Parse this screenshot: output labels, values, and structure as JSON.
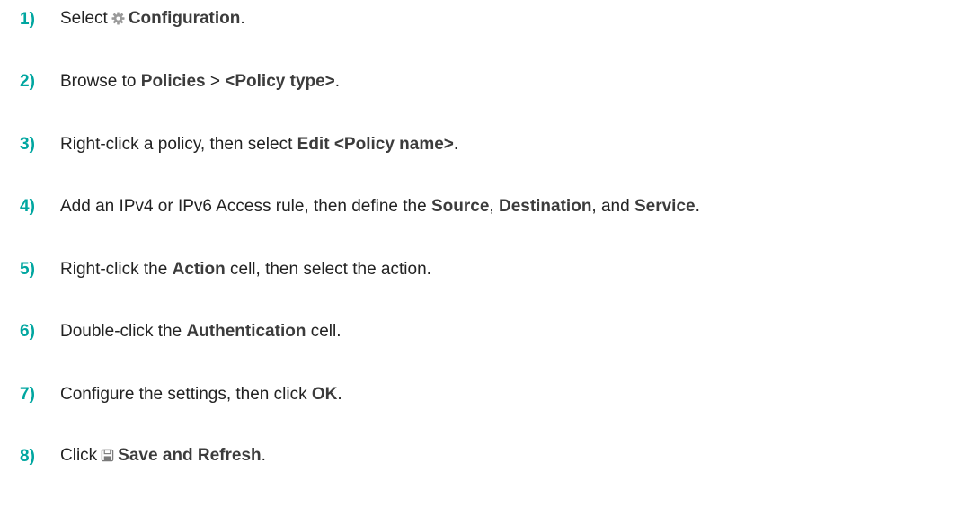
{
  "steps": [
    {
      "number": "1)",
      "parts": [
        "Select",
        "Configuration",
        "."
      ],
      "icon": "gear-icon"
    },
    {
      "number": "2)",
      "parts": [
        "Browse to",
        "Policies",
        ">",
        "<Policy type>",
        "."
      ]
    },
    {
      "number": "3)",
      "parts": [
        "Right-click a policy, then select",
        "Edit <Policy name>",
        "."
      ]
    },
    {
      "number": "4)",
      "parts": [
        "Add an IPv4 or IPv6 Access rule, then define the",
        "Source",
        ",",
        "Destination",
        ", and",
        "Service",
        "."
      ]
    },
    {
      "number": "5)",
      "parts": [
        "Right-click the",
        "Action",
        "cell, then select the action."
      ]
    },
    {
      "number": "6)",
      "parts": [
        "Double-click the",
        "Authentication",
        "cell."
      ]
    },
    {
      "number": "7)",
      "parts": [
        "Configure the settings, then click",
        "OK",
        "."
      ]
    },
    {
      "number": "8)",
      "parts": [
        "Click",
        "Save and Refresh",
        "."
      ],
      "icon": "save-icon"
    }
  ],
  "colors": {
    "step_number": "#00a6a0",
    "text": "#222222",
    "bold_text": "#3c3c3c",
    "icon": "#9a9a9a"
  }
}
